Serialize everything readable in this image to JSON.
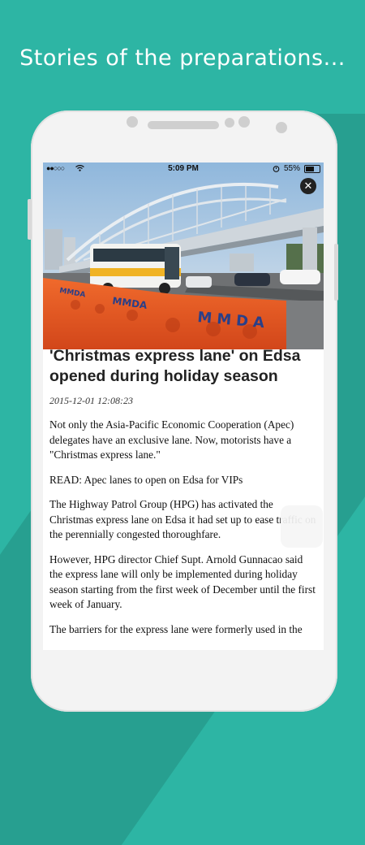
{
  "headline": {
    "bold_word": "Stories",
    "rest": " of the preparations..."
  },
  "statusbar": {
    "signal": "●●○○○",
    "time": "5:09 PM",
    "battery": "55%"
  },
  "hero": {
    "banner_text_1": "MMDA",
    "banner_text_2": "MMDA",
    "banner_text_3": "MMDA"
  },
  "article": {
    "title": "'Christmas express lane' on Edsa opened during holiday season",
    "date": "2015-12-01 12:08:23",
    "paragraphs": [
      "Not only the Asia-Pacific Economic Cooperation (Apec) delegates have an exclusive lane. Now, motorists have a \"Christmas express lane.\"",
      "READ: Apec lanes to open on Edsa for VIPs",
      "The Highway Patrol Group (HPG) has activated the Christmas express lane on Edsa it had set up to ease traffic on the perennially congested thoroughfare.",
      "However, HPG director Chief Supt. Arnold Gunnacao said the express lane will only be implemented during holiday season starting from the first week of December until the first week of January.",
      "The barriers for the express lane were formerly used in the"
    ]
  }
}
